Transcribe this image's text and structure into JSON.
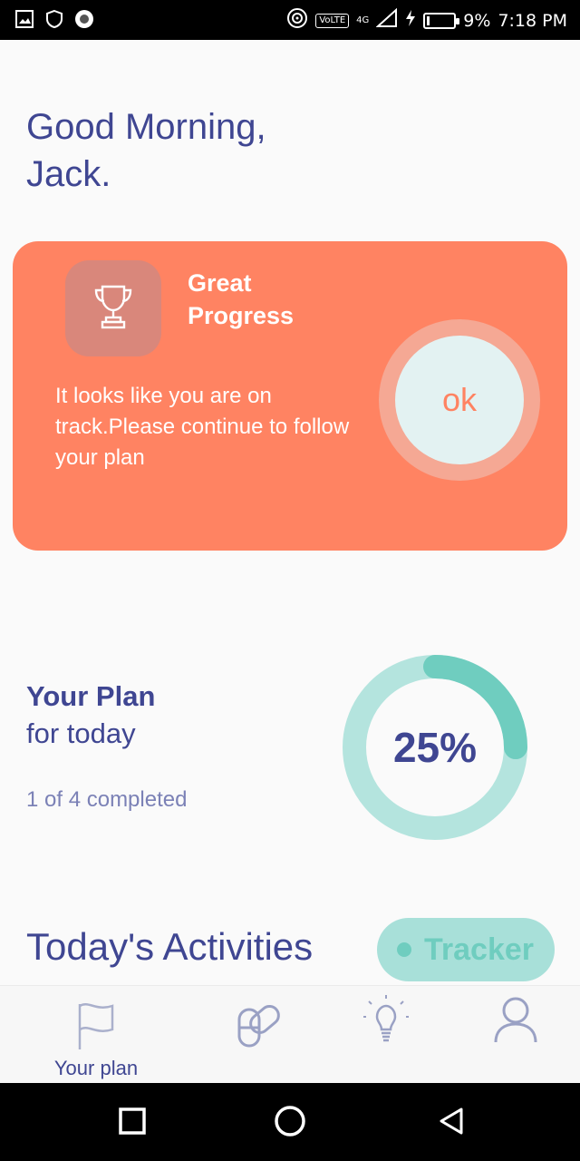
{
  "status_bar": {
    "battery_percent": "9%",
    "time": "7:18 PM",
    "volte": "VoLTE",
    "network": "4G",
    "battery_level": 0.09
  },
  "greeting": {
    "line1": "Good Morning,",
    "line2": "Jack."
  },
  "progress_card": {
    "title_line1": "Great",
    "title_line2": "Progress",
    "message": "It looks like you are on track.Please continue to follow your plan",
    "ok_label": "ok",
    "icon": "trophy-icon",
    "color": "#ff8362"
  },
  "plan": {
    "title": "Your Plan",
    "subtitle": "for today",
    "completed_text": "1 of 4 completed",
    "percent_label": "25%",
    "progress_fraction": 0.25,
    "track_color": "#b4e4de",
    "progress_color": "#6fcdbf"
  },
  "activities": {
    "title": "Today's Activities",
    "tracker_label": "Tracker"
  },
  "bottom_nav": {
    "items": [
      {
        "label": "Your plan",
        "icon": "flag-icon",
        "active": true
      },
      {
        "label": "",
        "icon": "pills-icon",
        "active": false
      },
      {
        "label": "",
        "icon": "lightbulb-icon",
        "active": false
      },
      {
        "label": "",
        "icon": "profile-icon",
        "active": false
      }
    ]
  },
  "android_nav": {
    "icons": [
      "recents-icon",
      "home-icon",
      "back-icon"
    ]
  }
}
